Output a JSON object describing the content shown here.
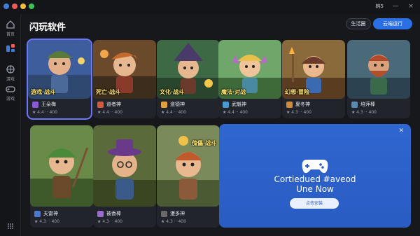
{
  "window": {
    "user_label": "韩5"
  },
  "sidebar": {
    "items": [
      {
        "icon": "home-icon",
        "label": "首页"
      },
      {
        "icon": "apps-icon",
        "label": ""
      },
      {
        "icon": "globe-icon",
        "label": "游戏"
      },
      {
        "icon": "gamepad-icon",
        "label": "游戏"
      },
      {
        "icon": "settings-icon",
        "label": ""
      }
    ]
  },
  "header": {
    "title": "闪玩软件",
    "secondary_button": "生活圈",
    "primary_button": "云端运行"
  },
  "cards": [
    {
      "caption": "游戏·战斗",
      "name": "王朵梅",
      "rating": "★ 4.4 ·· 400",
      "theme": "#4a6fb0"
    },
    {
      "caption": "死亡·战斗",
      "name": "道者神",
      "rating": "★ 4.4 ·· 400",
      "theme": "#6a4a2a"
    },
    {
      "caption": "文化·战斗",
      "name": "道德神",
      "rating": "★ 4.4 ·· 400",
      "theme": "#3a6a3a"
    },
    {
      "caption": "魔法·对战",
      "name": "武魁神",
      "rating": "★ 4.4 ·· 400",
      "theme": "#5a8a4a"
    },
    {
      "caption": "幻想·冒险",
      "name": "夏冬神",
      "rating": "★ 4.3 ·· 400",
      "theme": "#8a5a2a"
    },
    {
      "caption": "",
      "name": "培萍棒",
      "rating": "★ 4.3 ·· 400",
      "theme": "#4a6a7a"
    },
    {
      "caption": "",
      "name": "夫雷神",
      "rating": "★ 4.3 ·· 400",
      "theme": "#5a7a3a"
    },
    {
      "caption": "",
      "name": "被香棒",
      "rating": "★ 4.3 ·· 400",
      "theme": "#6a5a8a"
    },
    {
      "caption": "傀儡·战斗",
      "name": "漫多神",
      "rating": "★ 4.3 ·· 400",
      "theme": "#6a7a4a"
    }
  ],
  "promo": {
    "title": "Cortiedued #aveod",
    "subtitle": "Une Now",
    "button": "点击安装",
    "colors": {
      "bg": "#2b5fc8",
      "button_bg": "#e9f0ff"
    }
  },
  "colors": {
    "accent": "#2b6fe4",
    "background": "#17181c",
    "selected_outline": "#6b78ff"
  }
}
